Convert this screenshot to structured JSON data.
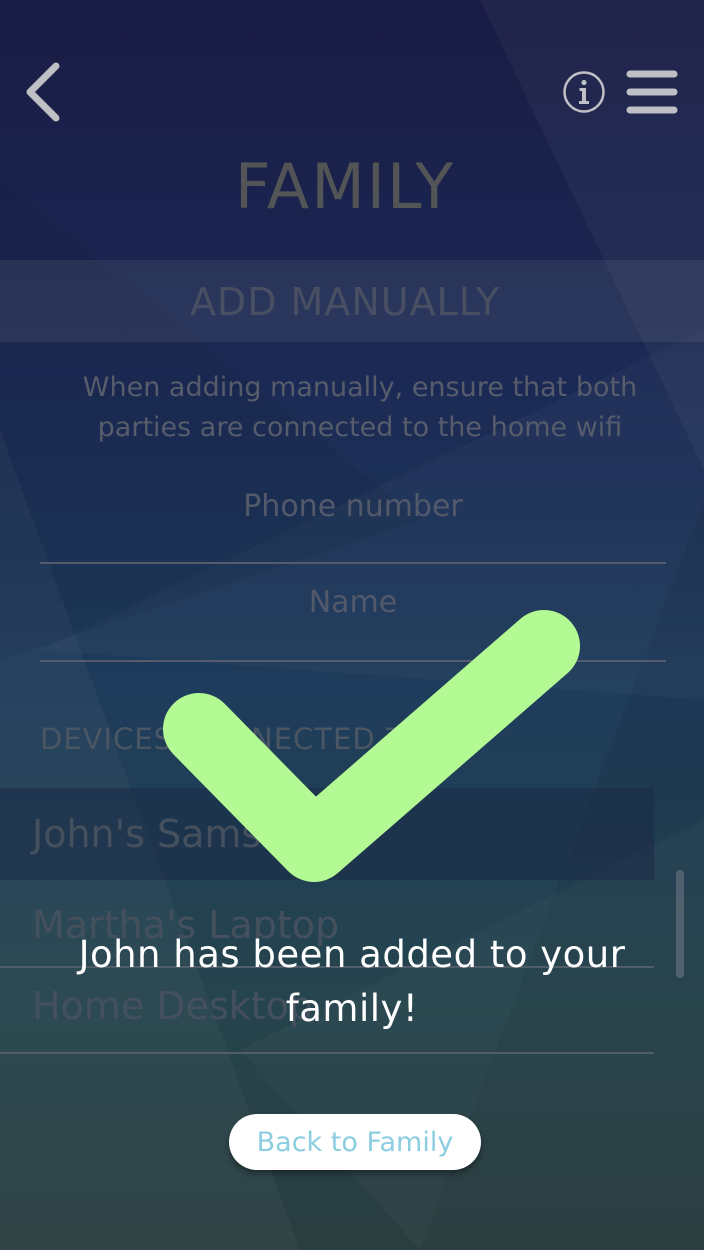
{
  "header": {
    "back_icon": "chevron-left-icon",
    "info_icon": "info-icon",
    "menu_icon": "hamburger-menu-icon"
  },
  "page": {
    "title": "FAMILY",
    "section_title": "ADD MANUALLY",
    "hint": "When adding manually, ensure that both parties are connected to the home wifi"
  },
  "form": {
    "phone_placeholder": "Phone number",
    "name_placeholder": "Name"
  },
  "devices": {
    "section_label": "DEVICES CONNECTED TO",
    "items": [
      {
        "label": "John's Samsung"
      },
      {
        "label": "Martha's Laptop"
      },
      {
        "label": "Home Desktop"
      }
    ]
  },
  "overlay": {
    "check_icon": "checkmark-icon",
    "check_color": "#b4fa94",
    "message": "John has been added to your family!",
    "button_label": "Back to Family",
    "button_text_color": "#8ccde0"
  }
}
